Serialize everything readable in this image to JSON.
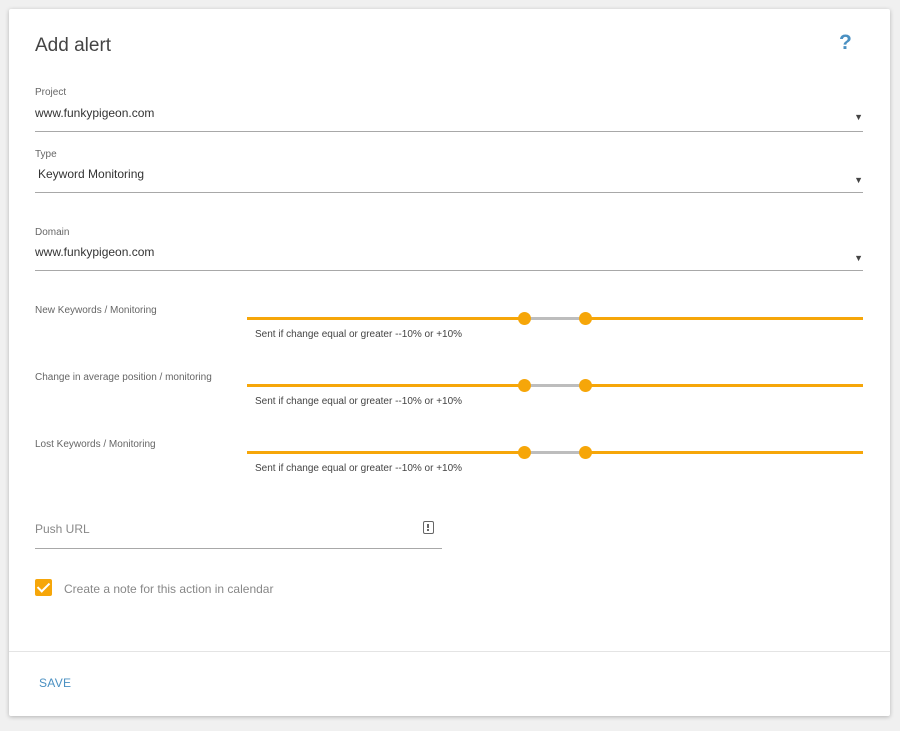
{
  "dialog": {
    "title": "Add alert",
    "help_glyph": "?"
  },
  "fields": {
    "project": {
      "label": "Project",
      "value": "www.funkypigeon.com"
    },
    "type": {
      "label": "Type",
      "value": "Keyword Monitoring"
    },
    "domain": {
      "label": "Domain",
      "value": "www.funkypigeon.com"
    }
  },
  "dropdown_arrow": "▼",
  "sliders": [
    {
      "label": "New Keywords / Monitoring",
      "caption": "Sent if change equal or greater --10% or +10%",
      "range": [
        -100,
        100
      ],
      "low": -10,
      "high": 10
    },
    {
      "label": "Change in average position / monitoring",
      "caption": "Sent if change equal or greater --10% or +10%",
      "range": [
        -100,
        100
      ],
      "low": -10,
      "high": 10
    },
    {
      "label": "Lost Keywords / Monitoring",
      "caption": "Sent if change equal or greater --10% or +10%",
      "range": [
        -100,
        100
      ],
      "low": -10,
      "high": 10
    }
  ],
  "push_url": {
    "placeholder": "Push URL",
    "value": "",
    "icon": "push-alert-icon"
  },
  "calendar_note": {
    "label": "Create a note for this action in calendar",
    "checked": true
  },
  "footer": {
    "save_label": "SAVE"
  },
  "colors": {
    "accent": "#f6a609",
    "link": "#4a90c2",
    "track_inactive": "#bdbdbd"
  }
}
